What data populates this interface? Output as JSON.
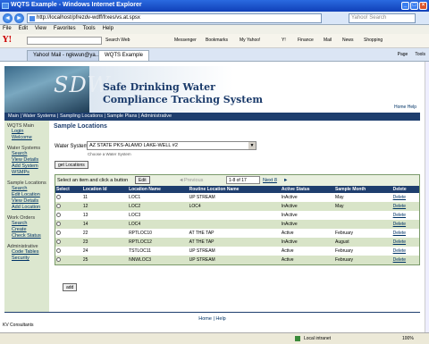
{
  "window": {
    "title": "WQTS Example - Windows Internet Explorer"
  },
  "browser": {
    "url": "http://localhost/pfrezdv-wdff/frxes/vs.at.spsx",
    "search_placeholder": "Yahoo! Search",
    "menu": [
      "File",
      "Edit",
      "View",
      "Favorites",
      "Tools",
      "Help"
    ],
    "toolbar_items": [
      "Search Web",
      "Messenger",
      "Bookmarks",
      "My Yahoo!",
      "Y!",
      "Finance",
      "Mail",
      "News",
      "Shopping"
    ],
    "tabs": [
      "Yahoo! Mail - ngkwun@ya...",
      "WQTS Example"
    ],
    "tab_tools": [
      "Page",
      "Tools"
    ]
  },
  "banner": {
    "logo_text": "SDW",
    "title_line1": "Safe Drinking Water",
    "title_line2": "Compliance Tracking System",
    "links": "Home  Help"
  },
  "main_nav": "Main | Water Systems | Sampling Locations | Sample Plans | Administrative",
  "sidebar": {
    "sections": [
      {
        "title": "WQTS Main",
        "links": [
          "Login",
          "Welcome"
        ]
      },
      {
        "title": "Water Systems",
        "links": [
          "Search",
          "View Details",
          "Add System",
          "WSMPs"
        ]
      },
      {
        "title": "Sample Locations",
        "links": [
          "Search",
          "Edit Location",
          "View Details",
          "Add Location"
        ]
      },
      {
        "title": "Work Orders",
        "links": [
          "Search",
          "Create",
          "Check Status"
        ]
      },
      {
        "title": "Administrative",
        "links": [
          "Code Tables",
          "Security"
        ]
      }
    ]
  },
  "content": {
    "heading": "Sample Locations",
    "water_system_label": "Water System:",
    "water_system_value": "AZ STATE PKS-ALAMO LAKE-WELL #2",
    "water_system_hint": "Choose a Water System",
    "get_locations_button": "get Locations",
    "grid_prompt": "Select an item and click a button",
    "edit_button": "Edit",
    "previous_label": "Previous",
    "pager_value": "1-8 of 17",
    "next_label": "Next 8",
    "columns": [
      "Select",
      "Location Id",
      "Location Name",
      "Routine Location Name",
      "Active Status",
      "Sample Month",
      "Delete"
    ],
    "rows": [
      [
        "11",
        "LOC1",
        "UP STREAM",
        "InActive",
        "May",
        "Delete"
      ],
      [
        "12",
        "LOC2",
        "LOC4",
        "InActive",
        "May",
        "Delete"
      ],
      [
        "13",
        "LOC3",
        "",
        "InActive",
        "",
        "Delete"
      ],
      [
        "14",
        "LOC4",
        "",
        "InActive",
        "",
        "Delete"
      ],
      [
        "22",
        "RPTLOC10",
        "AT THE TAP",
        "Active",
        "February",
        "Delete"
      ],
      [
        "23",
        "RPTLOC12",
        "AT THE TAP",
        "InActive",
        "August",
        "Delete"
      ],
      [
        "24",
        "TSTLOC11",
        "UP STREAM",
        "Active",
        "February",
        "Delete"
      ],
      [
        "25",
        "NNWLOC3",
        "UP STREAM",
        "Active",
        "February",
        "Delete"
      ]
    ],
    "add_button": "add"
  },
  "footer": "Home  |  Help",
  "bottom_note": "KV Consultants",
  "status": {
    "zone": "Local intranet",
    "zoom": "100%"
  }
}
